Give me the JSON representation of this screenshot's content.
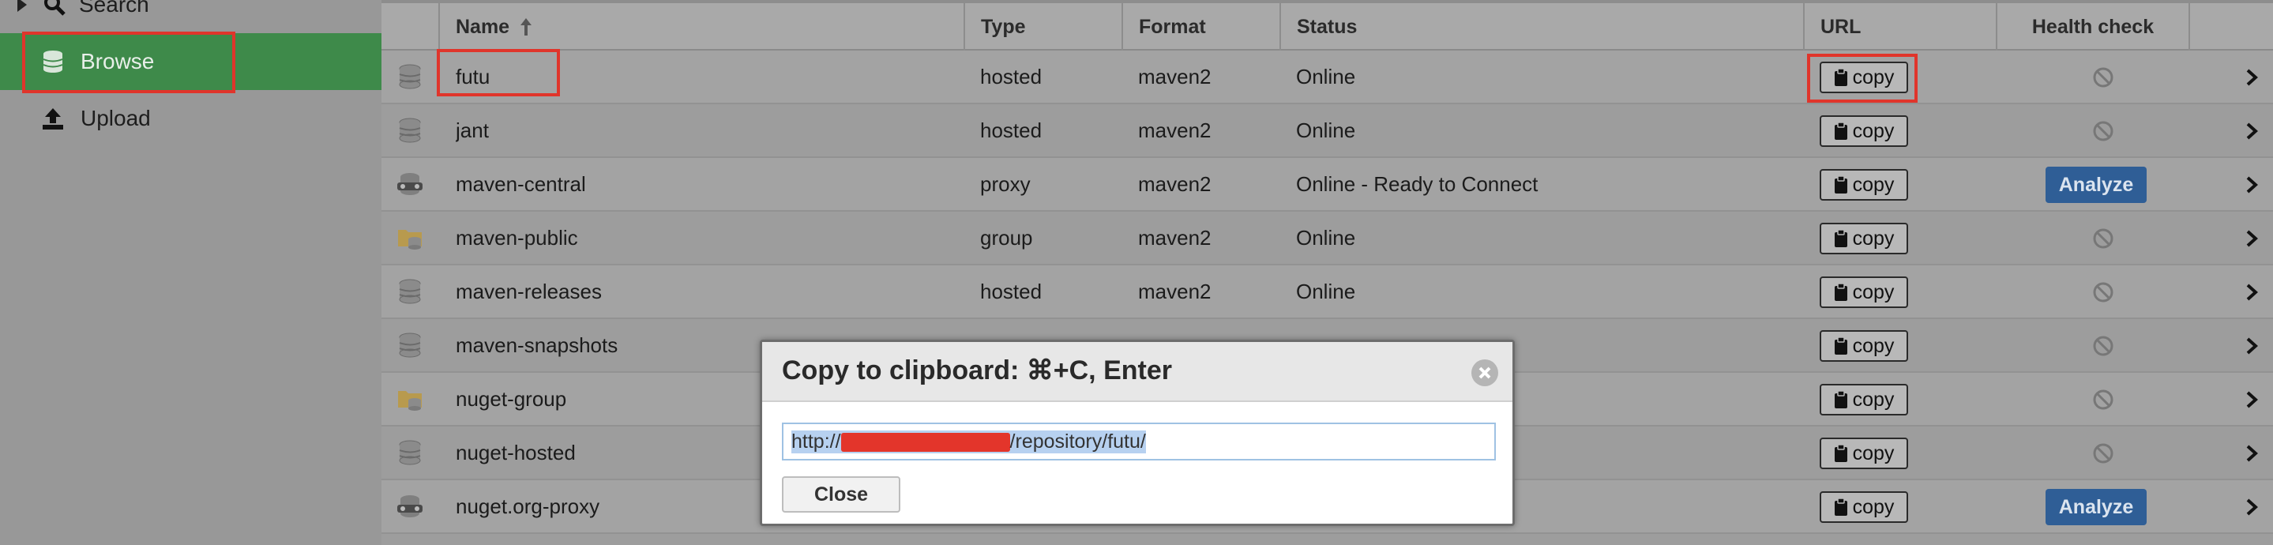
{
  "sidebar": {
    "items": [
      {
        "label": "Search",
        "icon": "search-icon"
      },
      {
        "label": "Browse",
        "icon": "database-icon",
        "selected": true
      },
      {
        "label": "Upload",
        "icon": "upload-icon"
      }
    ]
  },
  "grid": {
    "columns": [
      "Name",
      "Type",
      "Format",
      "Status",
      "URL",
      "Health check"
    ],
    "sort_indicator": "ascending",
    "copy_label": "copy",
    "analyze_label": "Analyze",
    "rows": [
      {
        "name": "futu",
        "type": "hosted",
        "format": "maven2",
        "status": "Online",
        "icon": "hosted-repo-icon",
        "health": "disabled"
      },
      {
        "name": "jant",
        "type": "hosted",
        "format": "maven2",
        "status": "Online",
        "icon": "hosted-repo-icon",
        "health": "disabled"
      },
      {
        "name": "maven-central",
        "type": "proxy",
        "format": "maven2",
        "status": "Online - Ready to Connect",
        "icon": "proxy-repo-icon",
        "health": "analyze"
      },
      {
        "name": "maven-public",
        "type": "group",
        "format": "maven2",
        "status": "Online",
        "icon": "group-repo-icon",
        "health": "disabled"
      },
      {
        "name": "maven-releases",
        "type": "hosted",
        "format": "maven2",
        "status": "Online",
        "icon": "hosted-repo-icon",
        "health": "disabled"
      },
      {
        "name": "maven-snapshots",
        "type": "",
        "format": "",
        "status": "",
        "icon": "hosted-repo-icon",
        "health": "disabled"
      },
      {
        "name": "nuget-group",
        "type": "",
        "format": "",
        "status": "",
        "icon": "group-repo-icon",
        "health": "disabled"
      },
      {
        "name": "nuget-hosted",
        "type": "",
        "format": "",
        "status": "",
        "icon": "hosted-repo-icon",
        "health": "disabled"
      },
      {
        "name": "nuget.org-proxy",
        "type": "",
        "format": "",
        "status": "ct",
        "icon": "proxy-repo-icon",
        "health": "analyze"
      }
    ]
  },
  "modal": {
    "title": "Copy to clipboard: ⌘+C, Enter",
    "url_prefix": "http://",
    "url_suffix": "/repository/futu/",
    "close_label": "Close"
  },
  "colors": {
    "highlight_box": "#e0352b",
    "browse_active": "#3e8a4a",
    "analyze_button": "#2f5e96",
    "selection": "#b7d1f0"
  }
}
